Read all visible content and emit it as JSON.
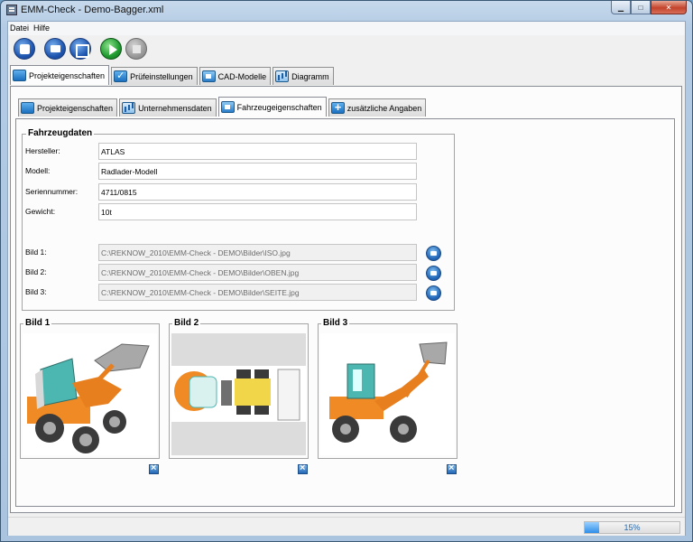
{
  "window": {
    "title": "EMM-Check - Demo-Bagger.xml"
  },
  "menu": [
    "Datei",
    "Hilfe"
  ],
  "toolbar": [
    "new",
    "open",
    "save",
    "run",
    "stop"
  ],
  "main_tabs": [
    {
      "label": "Projekteigenschaften",
      "icon": "speech-icon",
      "active": true
    },
    {
      "label": "Prüfeinstellungen",
      "icon": "check-icon",
      "active": false
    },
    {
      "label": "CAD-Modelle",
      "icon": "cad-icon",
      "active": false
    },
    {
      "label": "Diagramm",
      "icon": "chart-icon",
      "active": false
    }
  ],
  "sub_tabs": [
    {
      "label": "Projekteigenschaften",
      "active": false
    },
    {
      "label": "Unternehmensdaten",
      "active": false
    },
    {
      "label": "Fahrzeugeigenschaften",
      "active": true
    },
    {
      "label": "zusätzliche Angaben",
      "active": false
    }
  ],
  "vehicle": {
    "group_title": "Fahrzeugdaten",
    "fields": [
      {
        "label": "Hersteller:",
        "value": "ATLAS"
      },
      {
        "label": "Modell:",
        "value": "Radlader-Modell"
      },
      {
        "label": "Seriennummer:",
        "value": "4711/0815"
      },
      {
        "label": "Gewicht:",
        "value": "10t"
      }
    ],
    "images": [
      {
        "label": "Bild 1:",
        "path": "C:\\REKNOW_2010\\EMM-Check - DEMO\\Bilder\\ISO.jpg"
      },
      {
        "label": "Bild 2:",
        "path": "C:\\REKNOW_2010\\EMM-Check - DEMO\\Bilder\\OBEN.jpg"
      },
      {
        "label": "Bild 3:",
        "path": "C:\\REKNOW_2010\\EMM-Check - DEMO\\Bilder\\SEITE.jpg"
      }
    ]
  },
  "previews": [
    {
      "title": "Bild 1"
    },
    {
      "title": "Bild 2"
    },
    {
      "title": "Bild 3"
    }
  ],
  "colors": {
    "loader_body": "#f08a24",
    "cab_glass": "#4cb6b0",
    "tyre": "#3a3a3a"
  },
  "status": {
    "progress_text": "15%",
    "progress_value": 0.15
  }
}
